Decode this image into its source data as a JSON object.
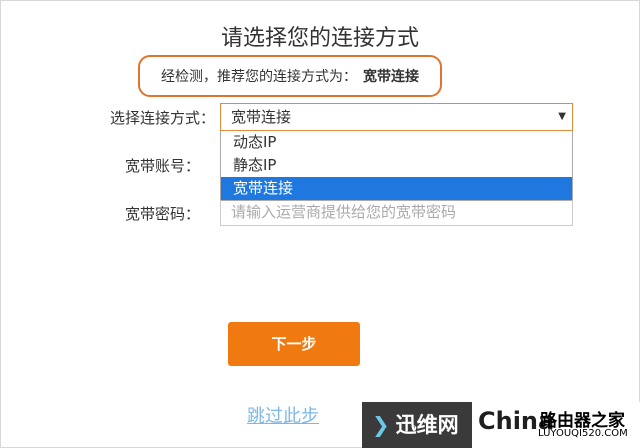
{
  "page": {
    "title": "请选择您的连接方式"
  },
  "detection": {
    "prefix": "经检测，推荐您的连接方式为：",
    "value": "宽带连接"
  },
  "form": {
    "connection_label": "选择连接方式：",
    "connection_value": "宽带连接",
    "connection_options": [
      "动态IP",
      "静态IP",
      "宽带连接"
    ],
    "account_label": "宽带账号：",
    "password_label": "宽带密码：",
    "password_placeholder": "请输入运营商提供给您的宽带密码"
  },
  "buttons": {
    "next": "下一步",
    "skip": "跳过此步"
  },
  "watermark": {
    "brand1": "迅维网",
    "brand2": "China",
    "brand3": "路由器之家",
    "url": "LUYOUQI520.COM"
  }
}
